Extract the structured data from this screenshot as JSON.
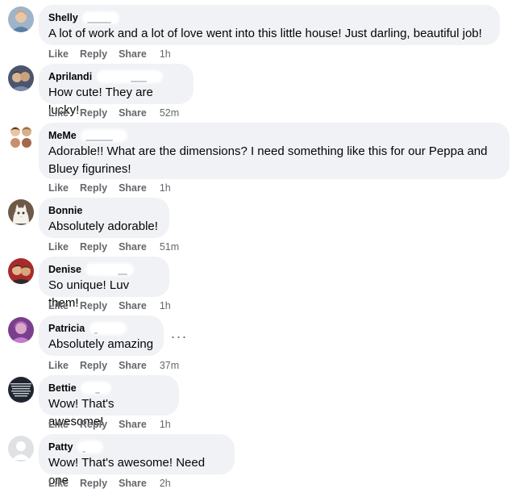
{
  "action_labels": {
    "like": "Like",
    "reply": "Reply",
    "share": "Share"
  },
  "more_glyph": "···",
  "comments": [
    {
      "name": "Shelly",
      "text": "A lot of work and a lot of love went into this little house! Just darling, beautiful job!",
      "time": "1h"
    },
    {
      "name": "Aprilandi",
      "text": "How cute! They are lucky!",
      "time": "52m"
    },
    {
      "name": "MeMe",
      "text": "Adorable!! What are the dimensions? I need something like this for our Peppa and Bluey figurines!",
      "time": "1h"
    },
    {
      "name": "Bonnie",
      "text": "Absolutely adorable!",
      "time": "51m"
    },
    {
      "name": "Denise",
      "text": "So unique! Luv them!",
      "time": "1h"
    },
    {
      "name": "Patricia",
      "text": "Absolutely amazing",
      "time": "37m"
    },
    {
      "name": "Bettie",
      "text": "Wow! That's awesome!",
      "time": "1h"
    },
    {
      "name": "Patty",
      "text": "Wow! That's awesome! Need one",
      "time": "2h"
    }
  ]
}
